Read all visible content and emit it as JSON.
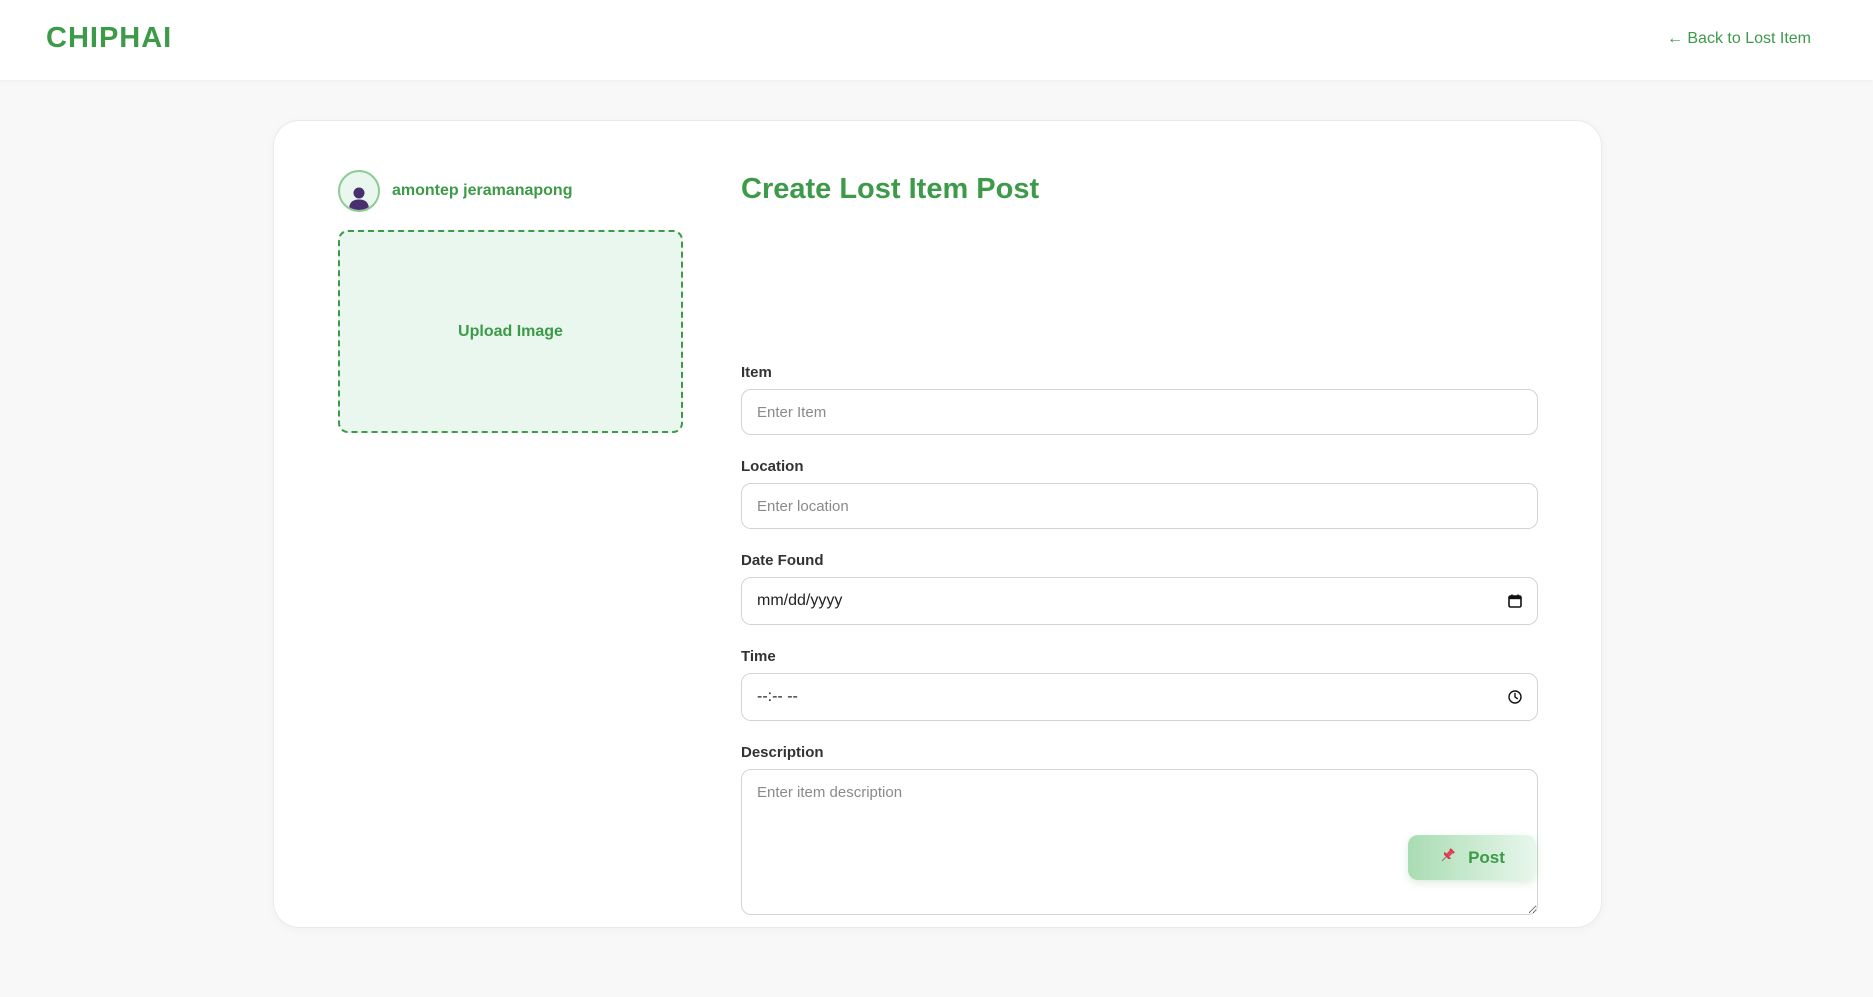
{
  "header": {
    "brand": "CHIPHAI",
    "back_link": "← Back to Lost Item"
  },
  "user": {
    "name": "amontep jeramanapong",
    "avatar_icon": "person-icon"
  },
  "upload": {
    "label": "Upload Image"
  },
  "form": {
    "title": "Create Lost Item Post",
    "item": {
      "label": "Item",
      "placeholder": "Enter Item"
    },
    "location": {
      "label": "Location",
      "placeholder": "Enter location"
    },
    "date": {
      "label": "Date Found",
      "display": "mm/dd/yyyy",
      "icon": "calendar-icon"
    },
    "time": {
      "label": "Time",
      "display": "--:-- --",
      "icon": "clock-icon"
    },
    "description": {
      "label": "Description",
      "placeholder": "Enter item description"
    }
  },
  "actions": {
    "post_label": "Post",
    "post_icon": "pushpin-icon"
  },
  "colors": {
    "brand_green": "#3c9a48",
    "upload_bg": "#e9f7ee",
    "page_bg": "#f7f8f7"
  }
}
